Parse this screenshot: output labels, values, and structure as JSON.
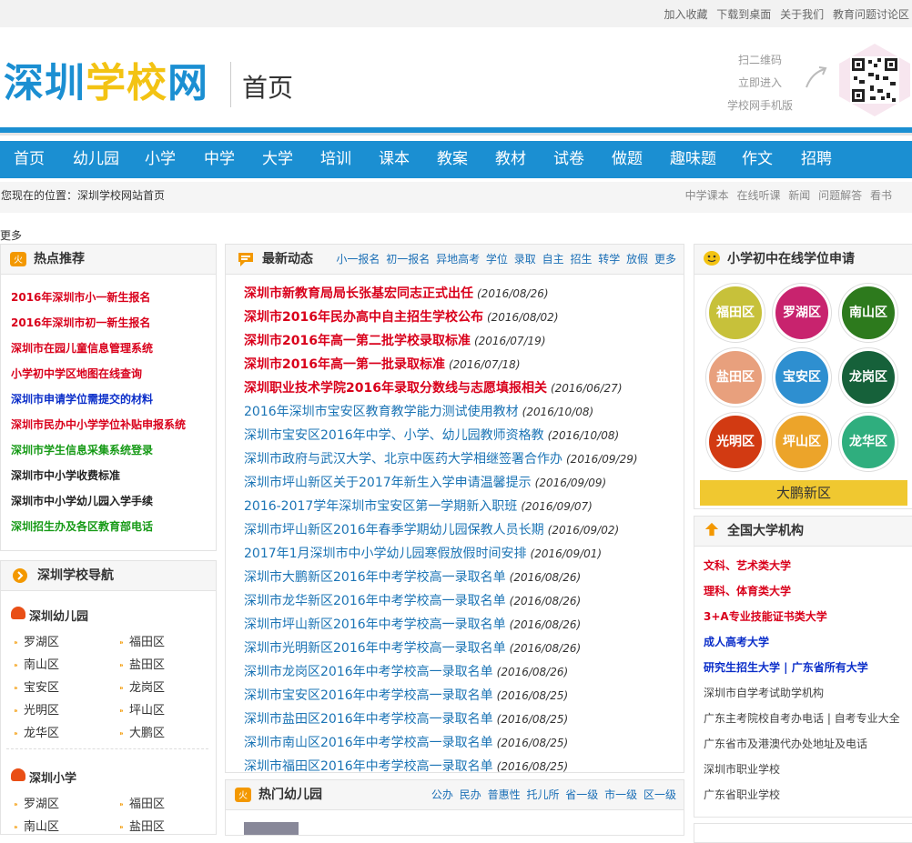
{
  "top_links": [
    "加入收藏",
    "下载到桌面",
    "关于我们",
    "教育问题讨论区"
  ],
  "logo": {
    "part1": "深圳",
    "part2": "学校",
    "part3": "网"
  },
  "page_name": "首页",
  "qr": {
    "line1": "扫二维码",
    "line2": "立即进入",
    "line3": "学校网手机版"
  },
  "nav": [
    "首页",
    "幼儿园",
    "小学",
    "中学",
    "大学",
    "培训",
    "课本",
    "教案",
    "教材",
    "试卷",
    "做题",
    "趣味题",
    "作文",
    "招聘"
  ],
  "breadcrumb": {
    "text": "您现在的位置：深圳学校网站首页",
    "right": [
      "中学课本",
      "在线听课",
      "新闻",
      "问题解答",
      "看书"
    ]
  },
  "more_label": "更多",
  "hot": {
    "title": "热点推荐",
    "items": [
      {
        "text": "2016年深圳市小一新生报名",
        "color": "red"
      },
      {
        "text": "2016年深圳市初一新生报名",
        "color": "red"
      },
      {
        "text": "深圳市在园儿童信息管理系统",
        "color": "red"
      },
      {
        "text": "小学初中学区地图在线查询",
        "color": "red"
      },
      {
        "text": "深圳市申请学位需提交的材料",
        "color": "blue"
      },
      {
        "text": "深圳市民办中小学学位补贴申报系统",
        "color": "red"
      },
      {
        "text": "深圳市学生信息采集系统登录",
        "color": "green"
      },
      {
        "text": "深圳市中小学收费标准",
        "color": "black"
      },
      {
        "text": "深圳市中小学幼儿园入学手续",
        "color": "black"
      },
      {
        "text": "深圳招生办及各区教育部电话",
        "color": "green"
      }
    ]
  },
  "school_nav": {
    "title": "深圳学校导航",
    "kindergarten": {
      "title": "深圳幼儿园",
      "areas": [
        "罗湖区",
        "福田区",
        "南山区",
        "盐田区",
        "宝安区",
        "龙岗区",
        "光明区",
        "坪山区",
        "龙华区",
        "大鹏区"
      ]
    },
    "primary": {
      "title": "深圳小学",
      "areas": [
        "罗湖区",
        "福田区",
        "南山区",
        "盐田区"
      ]
    }
  },
  "news": {
    "title": "最新动态",
    "links": [
      "小一报名",
      "初一报名",
      "异地高考",
      "学位",
      "录取",
      "自主",
      "招生",
      "转学",
      "放假",
      "更多"
    ],
    "items": [
      {
        "title": "深圳市新教育局局长张基宏同志正式出任",
        "date": "(2016/08/26)",
        "hot": true
      },
      {
        "title": "深圳市2016年民办高中自主招生学校公布",
        "date": "(2016/08/02)",
        "hot": true
      },
      {
        "title": "深圳市2016年高一第二批学校录取标准",
        "date": "(2016/07/19)",
        "hot": true
      },
      {
        "title": "深圳市2016年高一第一批录取标准",
        "date": "(2016/07/18)",
        "hot": true
      },
      {
        "title": "深圳职业技术学院2016年录取分数线与志愿填报相关",
        "date": "(2016/06/27)",
        "hot": true
      },
      {
        "title": "2016年深圳市宝安区教育教学能力测试使用教材",
        "date": "(2016/10/08)",
        "hot": false
      },
      {
        "title": "深圳市宝安区2016年中学、小学、幼儿园教师资格教",
        "date": "(2016/10/08)",
        "hot": false
      },
      {
        "title": "深圳市政府与武汉大学、北京中医药大学相继签署合作办",
        "date": "(2016/09/29)",
        "hot": false
      },
      {
        "title": "深圳市坪山新区关于2017年新生入学申请温馨提示",
        "date": "(2016/09/09)",
        "hot": false
      },
      {
        "title": "2016-2017学年深圳市宝安区第一学期新入职班",
        "date": "(2016/09/07)",
        "hot": false
      },
      {
        "title": "深圳市坪山新区2016年春季学期幼儿园保教人员长期",
        "date": "(2016/09/02)",
        "hot": false
      },
      {
        "title": "2017年1月深圳市中小学幼儿园寒假放假时间安排",
        "date": "(2016/09/01)",
        "hot": false
      },
      {
        "title": "深圳市大鹏新区2016年中考学校高一录取名单",
        "date": "(2016/08/26)",
        "hot": false
      },
      {
        "title": "深圳市龙华新区2016年中考学校高一录取名单",
        "date": "(2016/08/26)",
        "hot": false
      },
      {
        "title": "深圳市坪山新区2016年中考学校高一录取名单",
        "date": "(2016/08/26)",
        "hot": false
      },
      {
        "title": "深圳市光明新区2016年中考学校高一录取名单",
        "date": "(2016/08/26)",
        "hot": false
      },
      {
        "title": "深圳市龙岗区2016年中考学校高一录取名单",
        "date": "(2016/08/26)",
        "hot": false
      },
      {
        "title": "深圳市宝安区2016年中考学校高一录取名单",
        "date": "(2016/08/25)",
        "hot": false
      },
      {
        "title": "深圳市盐田区2016年中考学校高一录取名单",
        "date": "(2016/08/25)",
        "hot": false
      },
      {
        "title": "深圳市南山区2016年中考学校高一录取名单",
        "date": "(2016/08/25)",
        "hot": false
      },
      {
        "title": "深圳市福田区2016年中考学校高一录取名单",
        "date": "(2016/08/25)",
        "hot": false
      }
    ]
  },
  "kinder_hot": {
    "title": "热门幼儿园",
    "links": [
      "公办",
      "民办",
      "普惠性",
      "托儿所",
      "省一级",
      "市一级",
      "区一级"
    ]
  },
  "apply": {
    "title": "小学初中在线学位申请",
    "districts": [
      {
        "name": "福田区",
        "color": "#c7c13a"
      },
      {
        "name": "罗湖区",
        "color": "#c8236e"
      },
      {
        "name": "南山区",
        "color": "#2d7a1d"
      },
      {
        "name": "盐田区",
        "color": "#e8a07d"
      },
      {
        "name": "宝安区",
        "color": "#2e8fd0"
      },
      {
        "name": "龙岗区",
        "color": "#16613a"
      },
      {
        "name": "光明区",
        "color": "#d23a12"
      },
      {
        "name": "坪山区",
        "color": "#eca42a"
      },
      {
        "name": "龙华区",
        "color": "#2fae7e"
      }
    ],
    "extra": "大鹏新区"
  },
  "universities": {
    "title": "全国大学机构",
    "items": [
      {
        "text": "文科、艺术类大学",
        "color": "red"
      },
      {
        "text": "理科、体育类大学",
        "color": "red"
      },
      {
        "text": "3+A专业技能证书类大学",
        "color": "red"
      },
      {
        "text": "成人高考大学",
        "color": "blue"
      },
      {
        "text": "研究生招生大学 | 广东省所有大学",
        "color": "blue"
      },
      {
        "text": "深圳市自学考试助学机构",
        "color": "plain"
      },
      {
        "text": "广东主考院校自考办电话 | 自考专业大全",
        "color": "plain"
      },
      {
        "text": "广东省市及港澳代办处地址及电话",
        "color": "plain"
      },
      {
        "text": "深圳市职业学校",
        "color": "plain"
      },
      {
        "text": "广东省职业学校",
        "color": "plain"
      }
    ]
  },
  "colors": {
    "brand_blue": "#1b8fd2",
    "logo_yellow": "#f3c313",
    "hot_red": "#d9001b"
  }
}
